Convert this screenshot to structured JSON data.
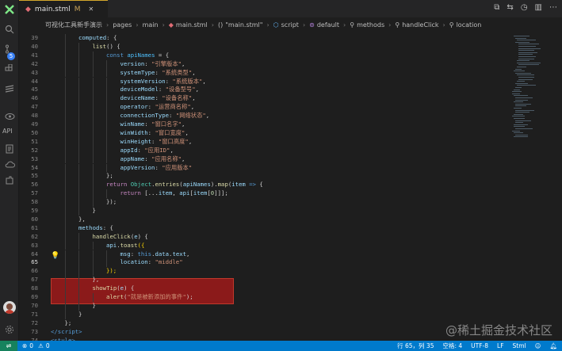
{
  "tab": {
    "filename": "main.stml",
    "modified": "M"
  },
  "tab_actions": [
    "split-icon",
    "compare-icon",
    "history-icon",
    "sidebar-icon",
    "more-icon"
  ],
  "breadcrumb": [
    "可视化工具新手演示",
    "pages",
    "main",
    "main.stml",
    "\"main.stml\"",
    "script",
    "default",
    "methods",
    "handleClick",
    "location"
  ],
  "activity": {
    "scm_badge": "5",
    "api_label": "API"
  },
  "editor": {
    "current_line": 65,
    "lines": [
      {
        "n": 39,
        "indent": 2,
        "tokens": [
          [
            "v",
            "computed"
          ],
          [
            "p",
            ": {"
          ]
        ]
      },
      {
        "n": 40,
        "indent": 3,
        "tokens": [
          [
            "f",
            "list"
          ],
          [
            "p",
            "() {"
          ]
        ]
      },
      {
        "n": 41,
        "indent": 4,
        "tokens": [
          [
            "b",
            "const "
          ],
          [
            "cyan",
            "apiNames"
          ],
          [
            "p",
            " = {"
          ]
        ]
      },
      {
        "n": 42,
        "indent": 5,
        "tokens": [
          [
            "v",
            "version"
          ],
          [
            "p",
            ": "
          ],
          [
            "s",
            "\"引擎版本\""
          ],
          [
            "p",
            ","
          ]
        ]
      },
      {
        "n": 43,
        "indent": 5,
        "tokens": [
          [
            "v",
            "systemType"
          ],
          [
            "p",
            ": "
          ],
          [
            "s",
            "\"系统类型\""
          ],
          [
            "p",
            ","
          ]
        ]
      },
      {
        "n": 44,
        "indent": 5,
        "tokens": [
          [
            "v",
            "systemVersion"
          ],
          [
            "p",
            ": "
          ],
          [
            "s",
            "\"系统版本\""
          ],
          [
            "p",
            ","
          ]
        ]
      },
      {
        "n": 45,
        "indent": 5,
        "tokens": [
          [
            "v",
            "deviceModel"
          ],
          [
            "p",
            ": "
          ],
          [
            "s",
            "\"设备型号\""
          ],
          [
            "p",
            ","
          ]
        ]
      },
      {
        "n": 46,
        "indent": 5,
        "tokens": [
          [
            "v",
            "deviceName"
          ],
          [
            "p",
            ": "
          ],
          [
            "s",
            "\"设备名称\""
          ],
          [
            "p",
            ","
          ]
        ]
      },
      {
        "n": 47,
        "indent": 5,
        "tokens": [
          [
            "v",
            "operator"
          ],
          [
            "p",
            ": "
          ],
          [
            "s",
            "\"运营商名称\""
          ],
          [
            "p",
            ","
          ]
        ]
      },
      {
        "n": 48,
        "indent": 5,
        "tokens": [
          [
            "v",
            "connectionType"
          ],
          [
            "p",
            ": "
          ],
          [
            "s",
            "\"网络状态\""
          ],
          [
            "p",
            ","
          ]
        ]
      },
      {
        "n": 49,
        "indent": 5,
        "tokens": [
          [
            "v",
            "winName"
          ],
          [
            "p",
            ": "
          ],
          [
            "s",
            "\"窗口名字\""
          ],
          [
            "p",
            ","
          ]
        ]
      },
      {
        "n": 50,
        "indent": 5,
        "tokens": [
          [
            "v",
            "winWidth"
          ],
          [
            "p",
            ": "
          ],
          [
            "s",
            "\"窗口宽度\""
          ],
          [
            "p",
            ","
          ]
        ]
      },
      {
        "n": 51,
        "indent": 5,
        "tokens": [
          [
            "v",
            "winHeight"
          ],
          [
            "p",
            ": "
          ],
          [
            "s",
            "\"窗口高度\""
          ],
          [
            "p",
            ","
          ]
        ]
      },
      {
        "n": 52,
        "indent": 5,
        "tokens": [
          [
            "v",
            "appId"
          ],
          [
            "p",
            ": "
          ],
          [
            "s",
            "\"应用ID\""
          ],
          [
            "p",
            ","
          ]
        ]
      },
      {
        "n": 53,
        "indent": 5,
        "tokens": [
          [
            "v",
            "appName"
          ],
          [
            "p",
            ": "
          ],
          [
            "s",
            "\"应用名称\""
          ],
          [
            "p",
            ","
          ]
        ]
      },
      {
        "n": 54,
        "indent": 5,
        "tokens": [
          [
            "v",
            "appVersion"
          ],
          [
            "p",
            ": "
          ],
          [
            "s",
            "\"应用版本\""
          ]
        ]
      },
      {
        "n": 55,
        "indent": 4,
        "tokens": [
          [
            "p",
            "};"
          ]
        ]
      },
      {
        "n": 56,
        "indent": 4,
        "tokens": [
          [
            "k",
            "return "
          ],
          [
            "t",
            "Object"
          ],
          [
            "p",
            "."
          ],
          [
            "f",
            "entries"
          ],
          [
            "p",
            "("
          ],
          [
            "v",
            "apiNames"
          ],
          [
            "p",
            ")."
          ],
          [
            "f",
            "map"
          ],
          [
            "p",
            "("
          ],
          [
            "v",
            "item"
          ],
          [
            "b",
            " => "
          ],
          [
            "p",
            "{"
          ]
        ]
      },
      {
        "n": 57,
        "indent": 5,
        "tokens": [
          [
            "k",
            "return "
          ],
          [
            "p",
            "[..."
          ],
          [
            "v",
            "item"
          ],
          [
            "p",
            ", "
          ],
          [
            "v",
            "api"
          ],
          [
            "p",
            "["
          ],
          [
            "v",
            "item"
          ],
          [
            "p",
            "["
          ],
          [
            "n",
            "0"
          ],
          [
            "p",
            "]]];"
          ]
        ]
      },
      {
        "n": 58,
        "indent": 4,
        "tokens": [
          [
            "p",
            "});"
          ]
        ]
      },
      {
        "n": 59,
        "indent": 3,
        "tokens": [
          [
            "p",
            "}"
          ]
        ]
      },
      {
        "n": 60,
        "indent": 2,
        "tokens": [
          [
            "p",
            "},"
          ]
        ]
      },
      {
        "n": 61,
        "indent": 2,
        "tokens": [
          [
            "v",
            "methods"
          ],
          [
            "p",
            ": {"
          ]
        ]
      },
      {
        "n": 62,
        "indent": 3,
        "tokens": [
          [
            "f",
            "handleClick"
          ],
          [
            "p",
            "("
          ],
          [
            "v",
            "e"
          ],
          [
            "p",
            ") {"
          ]
        ]
      },
      {
        "n": 63,
        "indent": 4,
        "tokens": [
          [
            "v",
            "api"
          ],
          [
            "p",
            "."
          ],
          [
            "f",
            "toast"
          ],
          [
            "y",
            "({"
          ]
        ]
      },
      {
        "n": 64,
        "indent": 5,
        "tokens": [
          [
            "v",
            "msg"
          ],
          [
            "p",
            ": "
          ],
          [
            "b",
            "this"
          ],
          [
            "p",
            "."
          ],
          [
            "v",
            "data"
          ],
          [
            "p",
            "."
          ],
          [
            "v",
            "text"
          ],
          [
            "p",
            ","
          ]
        ]
      },
      {
        "n": 65,
        "indent": 5,
        "tokens": [
          [
            "v",
            "location"
          ],
          [
            "p",
            ": "
          ],
          [
            "s",
            "\"middle\""
          ]
        ]
      },
      {
        "n": 66,
        "indent": 4,
        "tokens": [
          [
            "y",
            "});"
          ]
        ]
      },
      {
        "n": 67,
        "indent": 3,
        "tokens": [
          [
            "p",
            "},"
          ]
        ]
      },
      {
        "n": 68,
        "indent": 3,
        "tokens": [
          [
            "f",
            "showTip"
          ],
          [
            "p",
            "("
          ],
          [
            "v",
            "e"
          ],
          [
            "p",
            ") {"
          ]
        ]
      },
      {
        "n": 69,
        "indent": 4,
        "tokens": [
          [
            "f",
            "alert"
          ],
          [
            "p",
            "("
          ],
          [
            "s",
            "\"就是被新添加的事件\""
          ],
          [
            "p",
            ");"
          ]
        ]
      },
      {
        "n": 70,
        "indent": 3,
        "tokens": [
          [
            "p",
            "}"
          ]
        ]
      },
      {
        "n": 71,
        "indent": 2,
        "tokens": [
          [
            "p",
            "}"
          ]
        ]
      },
      {
        "n": 72,
        "indent": 1,
        "tokens": [
          [
            "p",
            "};"
          ]
        ]
      },
      {
        "n": 73,
        "indent": 0,
        "tokens": [
          [
            "b",
            "</"
          ],
          [
            "b",
            "script"
          ],
          [
            "b",
            ">"
          ]
        ]
      },
      {
        "n": 74,
        "indent": 0,
        "tokens": [
          [
            "b",
            "<"
          ],
          [
            "b",
            "style"
          ],
          [
            "b",
            ">"
          ]
        ]
      },
      {
        "n": 75,
        "indent": 1,
        "tokens": [
          [
            "s",
            ".main "
          ],
          [
            "p",
            "{"
          ]
        ]
      }
    ]
  },
  "watermark": "@稀土掘金技术社区",
  "status": {
    "errors": "0",
    "warnings": "0",
    "position": "行 65，列 35",
    "spaces": "空格: 4",
    "encoding": "UTF-8",
    "eol": "LF",
    "language": "Stml"
  },
  "colors": {
    "accent": "#007acc",
    "highlight": "#8b1a1a",
    "tab_border": "#d4a72c"
  }
}
